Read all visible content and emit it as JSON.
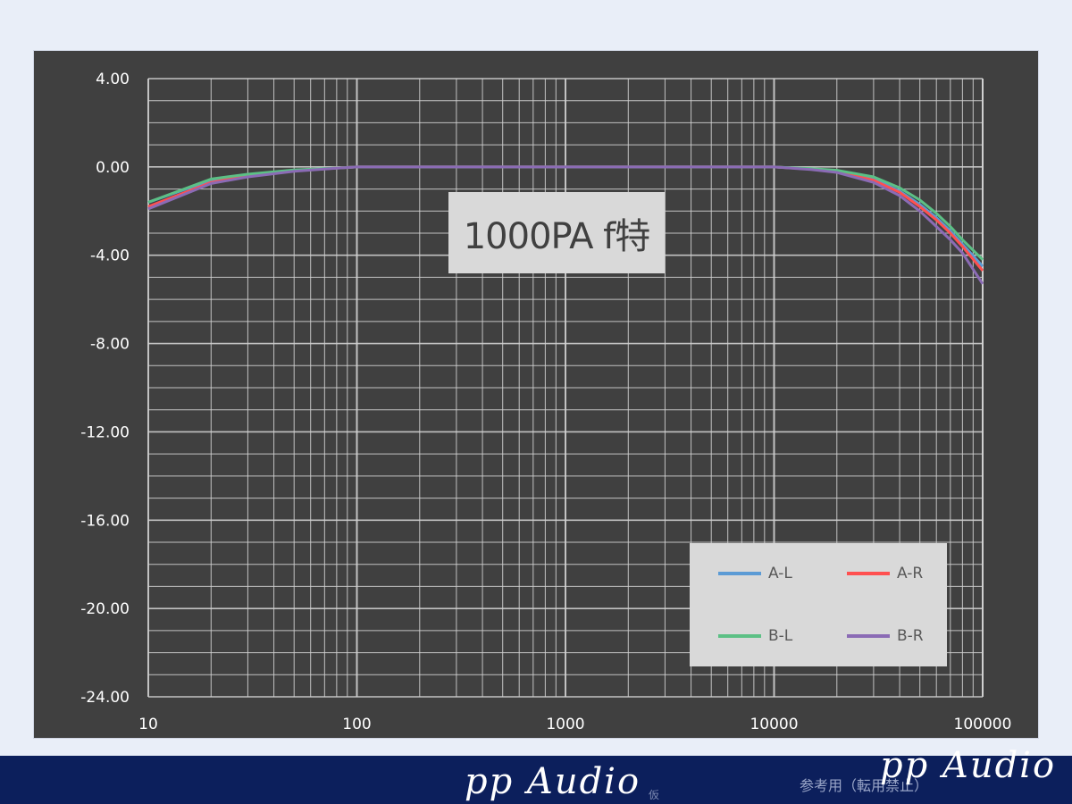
{
  "chart_data": {
    "type": "line",
    "title": "1000PA f特",
    "x_scale": "log",
    "xlim": [
      10,
      100000
    ],
    "ylim": [
      -24,
      4
    ],
    "x_ticks": [
      "10",
      "100",
      "1000",
      "10000",
      "100000"
    ],
    "y_ticks": [
      "4.00",
      "0.00",
      "-4.00",
      "-8.00",
      "-12.00",
      "-16.00",
      "-20.00",
      "-24.00"
    ],
    "grid": true,
    "legend_position": "bottom-right",
    "background": "#404040",
    "series": [
      {
        "name": "A-L",
        "color": "#5b9bd5",
        "points": [
          [
            10,
            -1.6
          ],
          [
            20,
            -0.6
          ],
          [
            30,
            -0.35
          ],
          [
            50,
            -0.15
          ],
          [
            80,
            -0.05
          ],
          [
            100,
            0
          ],
          [
            1000,
            0
          ],
          [
            10000,
            0
          ],
          [
            15000,
            -0.1
          ],
          [
            20000,
            -0.2
          ],
          [
            30000,
            -0.55
          ],
          [
            40000,
            -1.1
          ],
          [
            50000,
            -1.7
          ],
          [
            60000,
            -2.3
          ],
          [
            70000,
            -2.9
          ],
          [
            80000,
            -3.5
          ],
          [
            100000,
            -4.5
          ]
        ]
      },
      {
        "name": "A-R",
        "color": "#ff5050",
        "points": [
          [
            10,
            -1.8
          ],
          [
            20,
            -0.7
          ],
          [
            30,
            -0.4
          ],
          [
            50,
            -0.17
          ],
          [
            80,
            -0.05
          ],
          [
            100,
            0
          ],
          [
            1000,
            0
          ],
          [
            10000,
            0
          ],
          [
            15000,
            -0.1
          ],
          [
            20000,
            -0.22
          ],
          [
            30000,
            -0.6
          ],
          [
            40000,
            -1.15
          ],
          [
            50000,
            -1.8
          ],
          [
            60000,
            -2.4
          ],
          [
            70000,
            -3.0
          ],
          [
            80000,
            -3.6
          ],
          [
            100000,
            -4.7
          ]
        ]
      },
      {
        "name": "B-L",
        "color": "#5cc085",
        "points": [
          [
            10,
            -1.6
          ],
          [
            20,
            -0.55
          ],
          [
            30,
            -0.33
          ],
          [
            50,
            -0.14
          ],
          [
            80,
            -0.05
          ],
          [
            100,
            0
          ],
          [
            1000,
            0
          ],
          [
            10000,
            0
          ],
          [
            15000,
            -0.08
          ],
          [
            20000,
            -0.15
          ],
          [
            30000,
            -0.45
          ],
          [
            40000,
            -0.95
          ],
          [
            50000,
            -1.5
          ],
          [
            60000,
            -2.1
          ],
          [
            70000,
            -2.7
          ],
          [
            80000,
            -3.3
          ],
          [
            100000,
            -4.2
          ]
        ]
      },
      {
        "name": "B-R",
        "color": "#8b6bb5",
        "points": [
          [
            10,
            -1.9
          ],
          [
            20,
            -0.75
          ],
          [
            30,
            -0.45
          ],
          [
            50,
            -0.2
          ],
          [
            80,
            -0.06
          ],
          [
            100,
            0
          ],
          [
            1000,
            0
          ],
          [
            10000,
            0
          ],
          [
            15000,
            -0.12
          ],
          [
            20000,
            -0.25
          ],
          [
            30000,
            -0.7
          ],
          [
            40000,
            -1.3
          ],
          [
            50000,
            -2.0
          ],
          [
            60000,
            -2.7
          ],
          [
            70000,
            -3.3
          ],
          [
            80000,
            -3.9
          ],
          [
            100000,
            -5.3
          ]
        ]
      }
    ]
  },
  "footer": {
    "brand": "pp Audio",
    "brand_small": "仮",
    "note": "参考用（転用禁止）",
    "brand_right": "pp Audio"
  },
  "colors": {
    "page_bg": "#e9eef8",
    "plot_bg": "#404040",
    "grid": "#d0d0d0",
    "footer_bg": "#0c1f5c"
  }
}
